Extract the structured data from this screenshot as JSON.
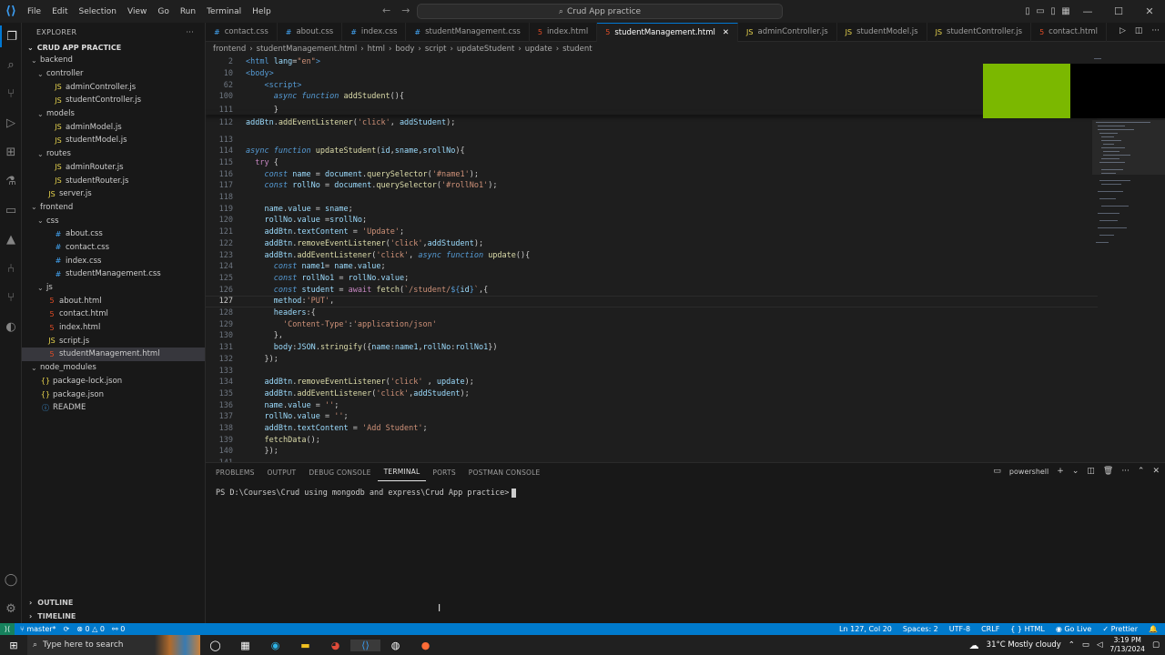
{
  "titlebar": {
    "menu": [
      "File",
      "Edit",
      "Selection",
      "View",
      "Go",
      "Run",
      "Terminal",
      "Help"
    ],
    "search_text": "Crud App practice"
  },
  "sidebar": {
    "header": "EXPLORER",
    "project": "CRUD APP PRACTICE",
    "tree": [
      {
        "label": "backend",
        "indent": 0,
        "type": "folder"
      },
      {
        "label": "controller",
        "indent": 1,
        "type": "folder"
      },
      {
        "label": "adminController.js",
        "indent": 2,
        "type": "js"
      },
      {
        "label": "studentController.js",
        "indent": 2,
        "type": "js"
      },
      {
        "label": "models",
        "indent": 1,
        "type": "folder"
      },
      {
        "label": "adminModel.js",
        "indent": 2,
        "type": "js"
      },
      {
        "label": "studentModel.js",
        "indent": 2,
        "type": "js"
      },
      {
        "label": "routes",
        "indent": 1,
        "type": "folder"
      },
      {
        "label": "adminRouter.js",
        "indent": 2,
        "type": "js"
      },
      {
        "label": "studentRouter.js",
        "indent": 2,
        "type": "js"
      },
      {
        "label": "server.js",
        "indent": 1,
        "type": "js"
      },
      {
        "label": "frontend",
        "indent": 0,
        "type": "folder"
      },
      {
        "label": "css",
        "indent": 1,
        "type": "folder"
      },
      {
        "label": "about.css",
        "indent": 2,
        "type": "css"
      },
      {
        "label": "contact.css",
        "indent": 2,
        "type": "css"
      },
      {
        "label": "index.css",
        "indent": 2,
        "type": "css"
      },
      {
        "label": "studentManagement.css",
        "indent": 2,
        "type": "css"
      },
      {
        "label": "js",
        "indent": 1,
        "type": "folder"
      },
      {
        "label": "about.html",
        "indent": 1,
        "type": "html"
      },
      {
        "label": "contact.html",
        "indent": 1,
        "type": "html"
      },
      {
        "label": "index.html",
        "indent": 1,
        "type": "html"
      },
      {
        "label": "script.js",
        "indent": 1,
        "type": "js"
      },
      {
        "label": "studentManagement.html",
        "indent": 1,
        "type": "html",
        "selected": true
      },
      {
        "label": "node_modules",
        "indent": 0,
        "type": "folder"
      },
      {
        "label": "package-lock.json",
        "indent": 0,
        "type": "json"
      },
      {
        "label": "package.json",
        "indent": 0,
        "type": "json"
      },
      {
        "label": "README",
        "indent": 0,
        "type": "readme"
      }
    ],
    "outline": "OUTLINE",
    "timeline": "TIMELINE"
  },
  "tabs": [
    {
      "label": "contact.css",
      "type": "css"
    },
    {
      "label": "about.css",
      "type": "css"
    },
    {
      "label": "index.css",
      "type": "css"
    },
    {
      "label": "studentManagement.css",
      "type": "css"
    },
    {
      "label": "index.html",
      "type": "html"
    },
    {
      "label": "studentManagement.html",
      "type": "html",
      "active": true
    },
    {
      "label": "adminController.js",
      "type": "js"
    },
    {
      "label": "studentModel.js",
      "type": "js"
    },
    {
      "label": "studentController.js",
      "type": "js"
    },
    {
      "label": "contact.html",
      "type": "html"
    }
  ],
  "breadcrumb": [
    "frontend",
    "studentManagement.html",
    "html",
    "body",
    "script",
    "updateStudent",
    "update",
    "student"
  ],
  "code": [
    {
      "n": "2",
      "t": [
        [
          "tag",
          "<html "
        ],
        [
          "attr",
          "lang"
        ],
        [
          "src",
          "="
        ],
        [
          "str",
          "\"en\""
        ],
        [
          "tag",
          ">"
        ]
      ]
    },
    {
      "n": "10",
      "t": [
        [
          "tag",
          "<body>"
        ]
      ]
    },
    {
      "n": "62",
      "t": [
        [
          "src",
          "    "
        ],
        [
          "tag",
          "<script>"
        ]
      ]
    },
    {
      "n": "100",
      "t": [
        [
          "src",
          "      "
        ],
        [
          "kwi",
          "async function "
        ],
        [
          "fn",
          "addStudent"
        ],
        [
          "src",
          "(){"
        ]
      ]
    },
    {
      "n": "111",
      "t": [
        [
          "src",
          "      }"
        ]
      ]
    },
    {
      "n": "112",
      "t": [
        [
          "var",
          "addBtn"
        ],
        [
          "src",
          "."
        ],
        [
          "fn",
          "addEventListener"
        ],
        [
          "src",
          "("
        ],
        [
          "str",
          "'click'"
        ],
        [
          "src",
          ", "
        ],
        [
          "var",
          "addStudent"
        ],
        [
          "src",
          ");"
        ]
      ]
    },
    {
      "n": "113",
      "t": []
    },
    {
      "n": "114",
      "t": [
        [
          "kwi",
          "async function "
        ],
        [
          "fn",
          "updateStudent"
        ],
        [
          "src",
          "("
        ],
        [
          "var",
          "id"
        ],
        [
          "src",
          ","
        ],
        [
          "var",
          "sname"
        ],
        [
          "src",
          ","
        ],
        [
          "var",
          "srollNo"
        ],
        [
          "src",
          "){"
        ]
      ]
    },
    {
      "n": "115",
      "t": [
        [
          "src",
          "  "
        ],
        [
          "ctl",
          "try "
        ],
        [
          "src",
          "{"
        ]
      ]
    },
    {
      "n": "116",
      "t": [
        [
          "src",
          "    "
        ],
        [
          "kwi",
          "const "
        ],
        [
          "var",
          "name"
        ],
        [
          "src",
          " = "
        ],
        [
          "var",
          "document"
        ],
        [
          "src",
          "."
        ],
        [
          "fn",
          "querySelector"
        ],
        [
          "src",
          "("
        ],
        [
          "str",
          "'#name1'"
        ],
        [
          "src",
          ");"
        ]
      ]
    },
    {
      "n": "117",
      "t": [
        [
          "src",
          "    "
        ],
        [
          "kwi",
          "const "
        ],
        [
          "var",
          "rollNo"
        ],
        [
          "src",
          " = "
        ],
        [
          "var",
          "document"
        ],
        [
          "src",
          "."
        ],
        [
          "fn",
          "querySelector"
        ],
        [
          "src",
          "("
        ],
        [
          "str",
          "'#rollNo1'"
        ],
        [
          "src",
          ");"
        ]
      ]
    },
    {
      "n": "118",
      "t": []
    },
    {
      "n": "119",
      "t": [
        [
          "src",
          "    "
        ],
        [
          "var",
          "name"
        ],
        [
          "src",
          "."
        ],
        [
          "prop",
          "value"
        ],
        [
          "src",
          " = "
        ],
        [
          "var",
          "sname"
        ],
        [
          "src",
          ";"
        ]
      ]
    },
    {
      "n": "120",
      "t": [
        [
          "src",
          "    "
        ],
        [
          "var",
          "rollNo"
        ],
        [
          "src",
          "."
        ],
        [
          "prop",
          "value"
        ],
        [
          "src",
          " ="
        ],
        [
          "var",
          "srollNo"
        ],
        [
          "src",
          ";"
        ]
      ]
    },
    {
      "n": "121",
      "t": [
        [
          "src",
          "    "
        ],
        [
          "var",
          "addBtn"
        ],
        [
          "src",
          "."
        ],
        [
          "prop",
          "textContent"
        ],
        [
          "src",
          " = "
        ],
        [
          "str",
          "'Update'"
        ],
        [
          "src",
          ";"
        ]
      ]
    },
    {
      "n": "122",
      "t": [
        [
          "src",
          "    "
        ],
        [
          "var",
          "addBtn"
        ],
        [
          "src",
          "."
        ],
        [
          "fn",
          "removeEventListener"
        ],
        [
          "src",
          "("
        ],
        [
          "str",
          "'click'"
        ],
        [
          "src",
          ","
        ],
        [
          "var",
          "addStudent"
        ],
        [
          "src",
          ");"
        ]
      ]
    },
    {
      "n": "123",
      "t": [
        [
          "src",
          "    "
        ],
        [
          "var",
          "addBtn"
        ],
        [
          "src",
          "."
        ],
        [
          "fn",
          "addEventListener"
        ],
        [
          "src",
          "("
        ],
        [
          "str",
          "'click'"
        ],
        [
          "src",
          ", "
        ],
        [
          "kwi",
          "async function "
        ],
        [
          "fn",
          "update"
        ],
        [
          "src",
          "(){"
        ]
      ]
    },
    {
      "n": "124",
      "t": [
        [
          "src",
          "      "
        ],
        [
          "kwi",
          "const "
        ],
        [
          "var",
          "name1"
        ],
        [
          "src",
          "= "
        ],
        [
          "var",
          "name"
        ],
        [
          "src",
          "."
        ],
        [
          "prop",
          "value"
        ],
        [
          "src",
          ";"
        ]
      ]
    },
    {
      "n": "125",
      "t": [
        [
          "src",
          "      "
        ],
        [
          "kwi",
          "const "
        ],
        [
          "var",
          "rollNo1"
        ],
        [
          "src",
          " = "
        ],
        [
          "var",
          "rollNo"
        ],
        [
          "src",
          "."
        ],
        [
          "prop",
          "value"
        ],
        [
          "src",
          ";"
        ]
      ]
    },
    {
      "n": "126",
      "t": [
        [
          "src",
          "      "
        ],
        [
          "kwi",
          "const "
        ],
        [
          "var",
          "student"
        ],
        [
          "src",
          " = "
        ],
        [
          "ctl",
          "await "
        ],
        [
          "fn",
          "fetch"
        ],
        [
          "src",
          "("
        ],
        [
          "str",
          "`/student/"
        ],
        [
          "kw",
          "${"
        ],
        [
          "var",
          "id"
        ],
        [
          "kw",
          "}"
        ],
        [
          "str",
          "`"
        ],
        [
          "src",
          ",{"
        ]
      ]
    },
    {
      "n": "127",
      "t": [
        [
          "src",
          "      "
        ],
        [
          "prop",
          "method"
        ],
        [
          "src",
          ":"
        ],
        [
          "str",
          "'PUT'"
        ],
        [
          "src",
          ","
        ]
      ],
      "current": true
    },
    {
      "n": "128",
      "t": [
        [
          "src",
          "      "
        ],
        [
          "prop",
          "headers"
        ],
        [
          "src",
          ":{"
        ]
      ]
    },
    {
      "n": "129",
      "t": [
        [
          "src",
          "        "
        ],
        [
          "str",
          "'Content-Type'"
        ],
        [
          "src",
          ":"
        ],
        [
          "str",
          "'application/json'"
        ]
      ]
    },
    {
      "n": "130",
      "t": [
        [
          "src",
          "      },"
        ]
      ]
    },
    {
      "n": "131",
      "t": [
        [
          "src",
          "      "
        ],
        [
          "prop",
          "body"
        ],
        [
          "src",
          ":"
        ],
        [
          "var",
          "JSON"
        ],
        [
          "src",
          "."
        ],
        [
          "fn",
          "stringify"
        ],
        [
          "src",
          "({"
        ],
        [
          "prop",
          "name"
        ],
        [
          "src",
          ":"
        ],
        [
          "var",
          "name1"
        ],
        [
          "src",
          ","
        ],
        [
          "prop",
          "rollNo"
        ],
        [
          "src",
          ":"
        ],
        [
          "var",
          "rollNo1"
        ],
        [
          "src",
          "})"
        ]
      ]
    },
    {
      "n": "132",
      "t": [
        [
          "src",
          "    });"
        ]
      ]
    },
    {
      "n": "133",
      "t": []
    },
    {
      "n": "134",
      "t": [
        [
          "src",
          "    "
        ],
        [
          "var",
          "addBtn"
        ],
        [
          "src",
          "."
        ],
        [
          "fn",
          "removeEventListener"
        ],
        [
          "src",
          "("
        ],
        [
          "str",
          "'click'"
        ],
        [
          "src",
          " , "
        ],
        [
          "var",
          "update"
        ],
        [
          "src",
          ");"
        ]
      ]
    },
    {
      "n": "135",
      "t": [
        [
          "src",
          "    "
        ],
        [
          "var",
          "addBtn"
        ],
        [
          "src",
          "."
        ],
        [
          "fn",
          "addEventListener"
        ],
        [
          "src",
          "("
        ],
        [
          "str",
          "'click'"
        ],
        [
          "src",
          ","
        ],
        [
          "var",
          "addStudent"
        ],
        [
          "src",
          ");"
        ]
      ]
    },
    {
      "n": "136",
      "t": [
        [
          "src",
          "    "
        ],
        [
          "var",
          "name"
        ],
        [
          "src",
          "."
        ],
        [
          "prop",
          "value"
        ],
        [
          "src",
          " = "
        ],
        [
          "str",
          "''"
        ],
        [
          "src",
          ";"
        ]
      ]
    },
    {
      "n": "137",
      "t": [
        [
          "src",
          "    "
        ],
        [
          "var",
          "rollNo"
        ],
        [
          "src",
          "."
        ],
        [
          "prop",
          "value"
        ],
        [
          "src",
          " = "
        ],
        [
          "str",
          "''"
        ],
        [
          "src",
          ";"
        ]
      ]
    },
    {
      "n": "138",
      "t": [
        [
          "src",
          "    "
        ],
        [
          "var",
          "addBtn"
        ],
        [
          "src",
          "."
        ],
        [
          "prop",
          "textContent"
        ],
        [
          "src",
          " = "
        ],
        [
          "str",
          "'Add Student'"
        ],
        [
          "src",
          ";"
        ]
      ]
    },
    {
      "n": "139",
      "t": [
        [
          "src",
          "    "
        ],
        [
          "fn",
          "fetchData"
        ],
        [
          "src",
          "();"
        ]
      ]
    },
    {
      "n": "140",
      "t": [
        [
          "src",
          "    });"
        ]
      ]
    },
    {
      "n": "141",
      "t": []
    }
  ],
  "panel": {
    "tabs": [
      "PROBLEMS",
      "OUTPUT",
      "DEBUG CONSOLE",
      "TERMINAL",
      "PORTS",
      "POSTMAN CONSOLE"
    ],
    "active_tab": "TERMINAL",
    "shell": "powershell",
    "prompt": "PS D:\\Courses\\Crud using mongodb and express\\Crud App practice>"
  },
  "statusbar": {
    "branch": "master*",
    "errors": "0",
    "warnings": "0",
    "ports": "0",
    "position": "Ln 127, Col 20",
    "spaces": "Spaces: 2",
    "encoding": "UTF-8",
    "eol": "CRLF",
    "language": "HTML",
    "golive": "Go Live",
    "prettier": "Prettier"
  },
  "taskbar": {
    "search_placeholder": "Type here to search",
    "weather": "31°C  Mostly cloudy",
    "time": "3:19 PM",
    "date": "7/13/2024"
  },
  "colors": {
    "accent": "#007acc",
    "green_box": "#7bb800"
  }
}
